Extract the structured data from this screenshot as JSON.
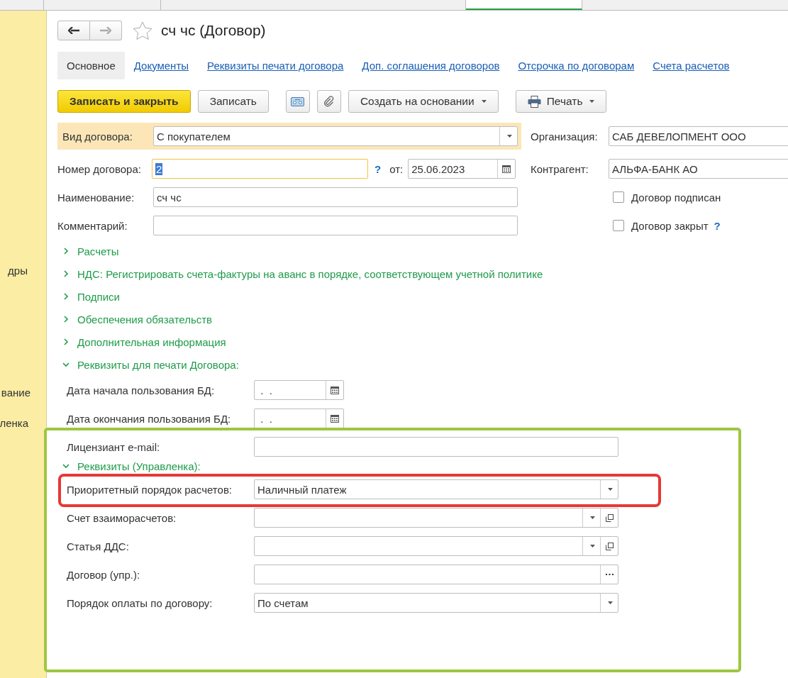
{
  "top_tabs": [
    {
      "selected": false
    },
    {
      "selected": false
    },
    {
      "selected": false
    },
    {
      "selected": true
    }
  ],
  "sidebar": {
    "items": [
      "дры",
      "вание",
      "ленка"
    ]
  },
  "header": {
    "title": "сч чс (Договор)",
    "favorite": false
  },
  "tabs": [
    {
      "label": "Основное",
      "selected": true
    },
    {
      "label": "Документы",
      "selected": false
    },
    {
      "label": "Реквизиты печати договора",
      "selected": false
    },
    {
      "label": "Доп. соглашения договоров",
      "selected": false
    },
    {
      "label": "Отсрочка по договорам",
      "selected": false
    },
    {
      "label": "Счета расчетов",
      "selected": false
    }
  ],
  "toolbar": [
    {
      "kind": "primary",
      "label": "Записать и закрыть"
    },
    {
      "kind": "plain",
      "label": "Записать"
    },
    {
      "kind": "tape"
    },
    {
      "kind": "clip"
    },
    {
      "kind": "menu",
      "label": "Создать на основании"
    },
    {
      "kind": "print",
      "label": "Печать"
    }
  ],
  "form": {
    "contract_type": {
      "label": "Вид договора:",
      "value": "С покупателем",
      "highlighted": true
    },
    "organization": {
      "label": "Организация:",
      "value": "САБ ДЕВЕЛОПМЕНТ ООО"
    },
    "number": {
      "label": "Номер договора:",
      "value": "2",
      "help": "?",
      "date_label": "от:",
      "date": "25.06.2023"
    },
    "counterparty": {
      "label": "Контрагент:",
      "value": "АЛЬФА-БАНК АО"
    },
    "name": {
      "label": "Наименование:",
      "value": "сч чс"
    },
    "signed": {
      "label": "Договор подписан",
      "checked": false
    },
    "comment": {
      "label": "Комментарий:"
    },
    "closed": {
      "label": "Договор закрыт",
      "checked": false,
      "help": "?"
    }
  },
  "sections": [
    {
      "title": "Расчеты",
      "expanded": false
    },
    {
      "title": "НДС: Регистрировать счета-фактуры на аванс в порядке, соответствующем учетной политике",
      "expanded": false
    },
    {
      "title": "Подписи",
      "expanded": false
    },
    {
      "title": "Обеспечения обязательств",
      "expanded": false
    },
    {
      "title": "Дополнительная информация",
      "expanded": false
    },
    {
      "title": "Реквизиты для печати Договора:",
      "expanded": true,
      "fields": [
        {
          "kind": "date",
          "label": "Дата начала пользования БД:",
          "value": " .  ."
        },
        {
          "kind": "date",
          "label": "Дата окончания пользования БД:",
          "value": " .  ."
        },
        {
          "kind": "text",
          "label": "Лицензиант e-mail:"
        }
      ],
      "children": [
        {
          "title": "Реквизиты (Управленка):",
          "expanded": true,
          "fields": [
            {
              "kind": "select",
              "label": "Приоритетный порядок расчетов:",
              "value": "Наличный платеж"
            },
            {
              "kind": "select_open",
              "label": "Счет взаиморасчетов:"
            },
            {
              "kind": "select_open",
              "label": "Статья ДДС:"
            },
            {
              "kind": "choice",
              "label": "Договор (упр.):"
            },
            {
              "kind": "select",
              "label": "Порядок оплаты по договору:",
              "value": "По счетам"
            }
          ]
        }
      ]
    }
  ],
  "annotations": [
    {
      "kind": "frame",
      "color": "#9dc741"
    },
    {
      "kind": "frame",
      "color": "#e53935"
    }
  ]
}
